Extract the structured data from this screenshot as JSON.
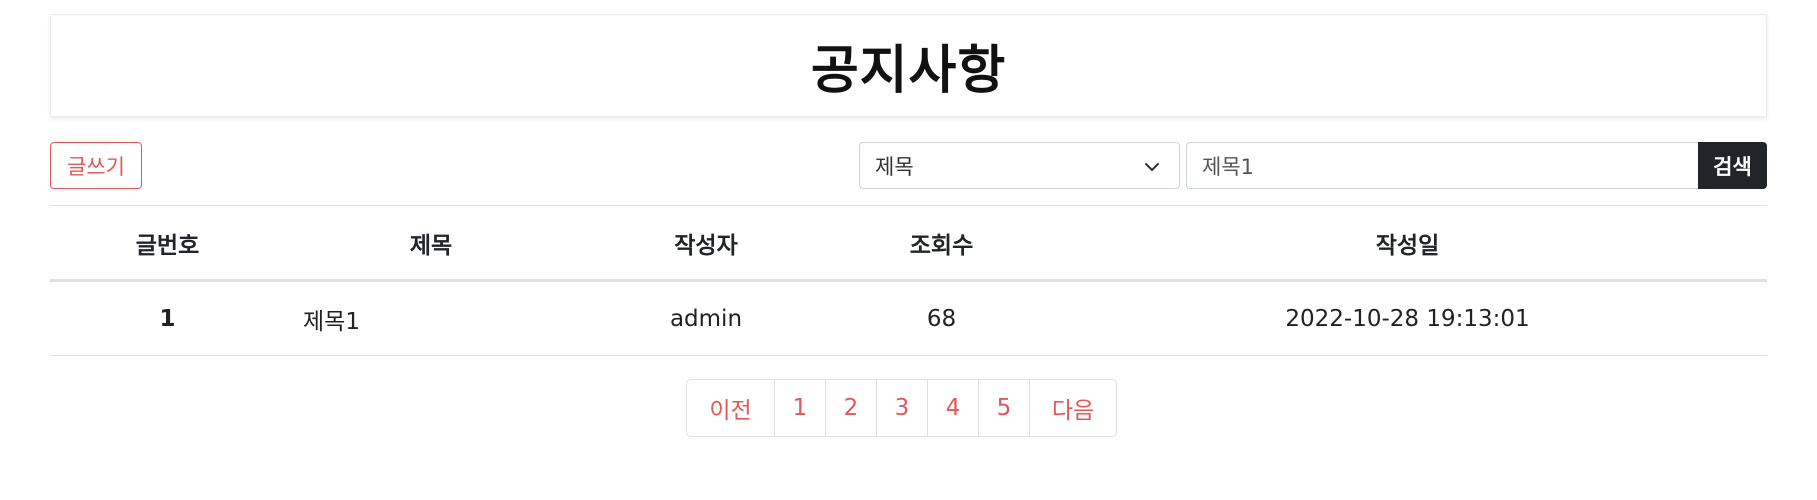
{
  "header": {
    "title": "공지사항"
  },
  "toolbar": {
    "write_label": "글쓰기",
    "search_field_selected": "제목",
    "search_value": "제목1",
    "search_button_label": "검색"
  },
  "table": {
    "columns": [
      "글번호",
      "제목",
      "작성자",
      "조회수",
      "작성일"
    ],
    "rows": [
      [
        "1",
        "제목1",
        "admin",
        "68",
        "2022-10-28 19:13:01"
      ]
    ]
  },
  "pagination": {
    "prev_label": "이전",
    "pages": [
      "1",
      "2",
      "3",
      "4",
      "5"
    ],
    "next_label": "다음"
  },
  "colors": {
    "accent": "#e4585a",
    "dark": "#212529",
    "border": "#dee2e6"
  },
  "icons": {
    "select_arrow": "chevron-down-icon"
  }
}
